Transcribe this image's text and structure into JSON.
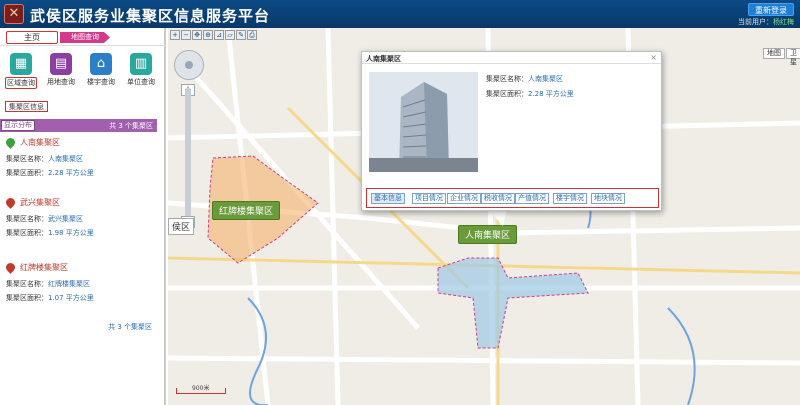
{
  "header": {
    "title": "武侯区服务业集聚区信息服务平台",
    "relogin_label": "重新登录",
    "current_user_label": "当前用户：",
    "current_user": "杨红梅"
  },
  "sidebar": {
    "tabs": [
      {
        "label": "主页"
      },
      {
        "label": "地图查询"
      }
    ],
    "query_buttons": [
      {
        "label": "区域查询",
        "icon": "grid-icon",
        "color": "#2aa8a0"
      },
      {
        "label": "用地查询",
        "icon": "land-icon",
        "color": "#8b3fa0"
      },
      {
        "label": "楼宇查询",
        "icon": "building-icon",
        "color": "#2b7fc7"
      },
      {
        "label": "单位查询",
        "icon": "company-icon",
        "color": "#2aa8a0"
      }
    ],
    "cluster_info_label": "集聚区信息",
    "distribution_label": "显示分布",
    "distribution_count": "共 3 个集聚区",
    "zones": [
      {
        "name": "人南集聚区",
        "name_label": "集聚区名称：",
        "name_value": "人南集聚区",
        "area_label": "集聚区面积：",
        "area_value": "2.28 平方公里",
        "pin_color": "#3aa23a"
      },
      {
        "name": "武兴集聚区",
        "name_label": "集聚区名称：",
        "name_value": "武兴集聚区",
        "area_label": "集聚区面积：",
        "area_value": "1.98 平方公里",
        "pin_color": "#c0392b"
      },
      {
        "name": "红牌楼集聚区",
        "name_label": "集聚区名称：",
        "name_value": "红牌楼集聚区",
        "area_label": "集聚区面积：",
        "area_value": "1.07 平方公里",
        "pin_color": "#c0392b"
      }
    ],
    "footer_count": "共 3 个集聚区"
  },
  "map": {
    "map_type_buttons": [
      "地图",
      "卫星"
    ],
    "region_label": "侯区",
    "scale_label": "900米",
    "labels": [
      {
        "text": "红牌楼集聚区"
      },
      {
        "text": "人南集聚区"
      }
    ]
  },
  "popup": {
    "title": "人南集聚区",
    "close": "×",
    "fields": [
      {
        "label": "集聚区名称：",
        "value": "人南集聚区"
      },
      {
        "label": "集聚区面积：",
        "value": "2.28 平方公里"
      }
    ],
    "tabs": [
      "基本信息",
      "项目情况",
      "企业情况",
      "税收情况",
      "产值情况",
      "楼宇情况",
      "地块情况"
    ]
  },
  "colors": {
    "header": "#0b4a86",
    "accent_pink": "#d23a8c",
    "distribution_bar": "#a15fae",
    "zone_orange": "#f5b36c",
    "zone_blue": "#9ec9e6",
    "link_blue": "#2b6ab3"
  }
}
